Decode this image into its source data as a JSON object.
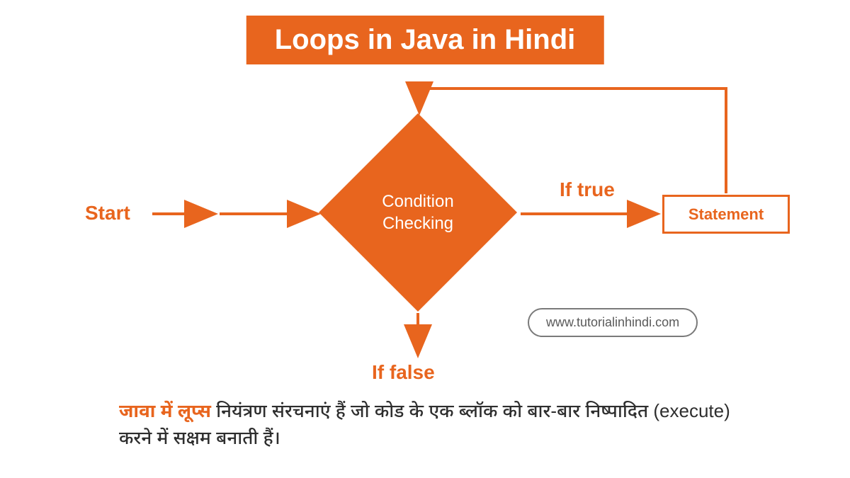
{
  "colors": {
    "accent": "#e8651e",
    "text": "#2e2e2e",
    "pill_border": "#7a7a7a"
  },
  "title": "Loops in Java in Hindi",
  "diagram": {
    "start_label": "Start",
    "condition_line1": "Condition",
    "condition_line2": "Checking",
    "true_label": "If true",
    "false_label": "If false",
    "statement_label": "Statement"
  },
  "url": "www.tutorialinhindi.com",
  "description": {
    "highlight": "जावा में लूप्स",
    "rest": " नियंत्रण संरचनाएं हैं जो कोड के एक ब्लॉक को बार-बार निष्पादित (execute) करने में सक्षम बनाती हैं।"
  }
}
